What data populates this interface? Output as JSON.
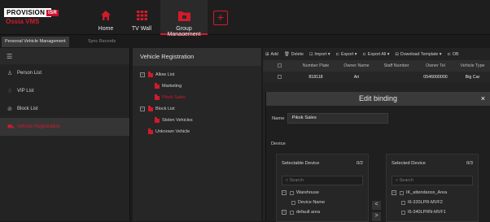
{
  "logo": {
    "brand_main": "PROVISION",
    "brand_mark": "ISR",
    "brand_sub": "Ossia VMS"
  },
  "nav": [
    {
      "label": "Home",
      "icon": "home-icon"
    },
    {
      "label": "TV Wall",
      "icon": "grid-icon"
    },
    {
      "label": "Group Management",
      "icon": "folder-icon"
    }
  ],
  "nav_add": "+",
  "tabs": [
    "Personal Vehicle Management",
    "Sync Records"
  ],
  "sidebar": {
    "menu_icon": "☰",
    "items": [
      {
        "label": "Person List",
        "icon": "person-icon",
        "glyph": "♙"
      },
      {
        "label": "VIP List",
        "icon": "shield-icon",
        "glyph": "♢"
      },
      {
        "label": "Block List",
        "icon": "block-icon",
        "glyph": "⊘"
      },
      {
        "label": "Vehicle Registration",
        "icon": "car-icon",
        "glyph": "⛟",
        "active": true
      }
    ]
  },
  "tree": {
    "title": "Vehicle Registration",
    "nodes": [
      {
        "label": "Allow List",
        "level": 0,
        "expander": "−"
      },
      {
        "label": "Marketing",
        "level": 1
      },
      {
        "label": "Pikok Sales",
        "level": 1,
        "selected": true
      },
      {
        "label": "Block List",
        "level": 0,
        "expander": "−"
      },
      {
        "label": "Stolen Vehicles",
        "level": 1
      },
      {
        "label": "Unknown Vehicle",
        "level": 0
      }
    ]
  },
  "toolbar": [
    {
      "label": "Add",
      "icon": "⊞"
    },
    {
      "label": "Delete",
      "icon": "🗑"
    },
    {
      "label": "Import ▾",
      "icon": "⊡"
    },
    {
      "label": "Export ▾",
      "icon": "⊏"
    },
    {
      "label": "Export All ▾",
      "icon": "⊏"
    },
    {
      "label": "Download Template ▾",
      "icon": "⊟"
    },
    {
      "label": "OB",
      "icon": "⊏"
    }
  ],
  "table": {
    "columns": [
      "Number Plate",
      "Owner Name",
      "Staff Number",
      "Owner Tel",
      "Vehicle Type"
    ],
    "rows": [
      [
        "818118",
        "Ari",
        "",
        "0546000000",
        "Big Car"
      ]
    ]
  },
  "dialog": {
    "title": "Edit binding",
    "close": "×",
    "name_label": "Name",
    "name_value": "Pikok Sales",
    "device_label": "Device",
    "selectable": {
      "title": "Selectable Device",
      "count": "0/2",
      "search_placeholder": "Search",
      "rows": [
        {
          "label": "Warehouse",
          "expander": "−",
          "indent": 0
        },
        {
          "label": "Device Name",
          "expander": "",
          "indent": 1
        },
        {
          "label": "default area",
          "expander": "−",
          "indent": 0
        }
      ]
    },
    "selected": {
      "title": "Selected Device",
      "count": "0/3",
      "search_placeholder": "Search",
      "rows": [
        {
          "label": "IK_attendance_Area",
          "expander": "−",
          "indent": 0
        },
        {
          "label": "I6-320LPR-MVF2",
          "expander": "",
          "indent": 1
        },
        {
          "label": "I6-340LPRN-MVF1",
          "expander": "",
          "indent": 1
        }
      ]
    },
    "arrow_left": "<",
    "arrow_right": ">"
  },
  "colors": {
    "accent": "#d11b2b",
    "background": "#1b1b1b"
  }
}
